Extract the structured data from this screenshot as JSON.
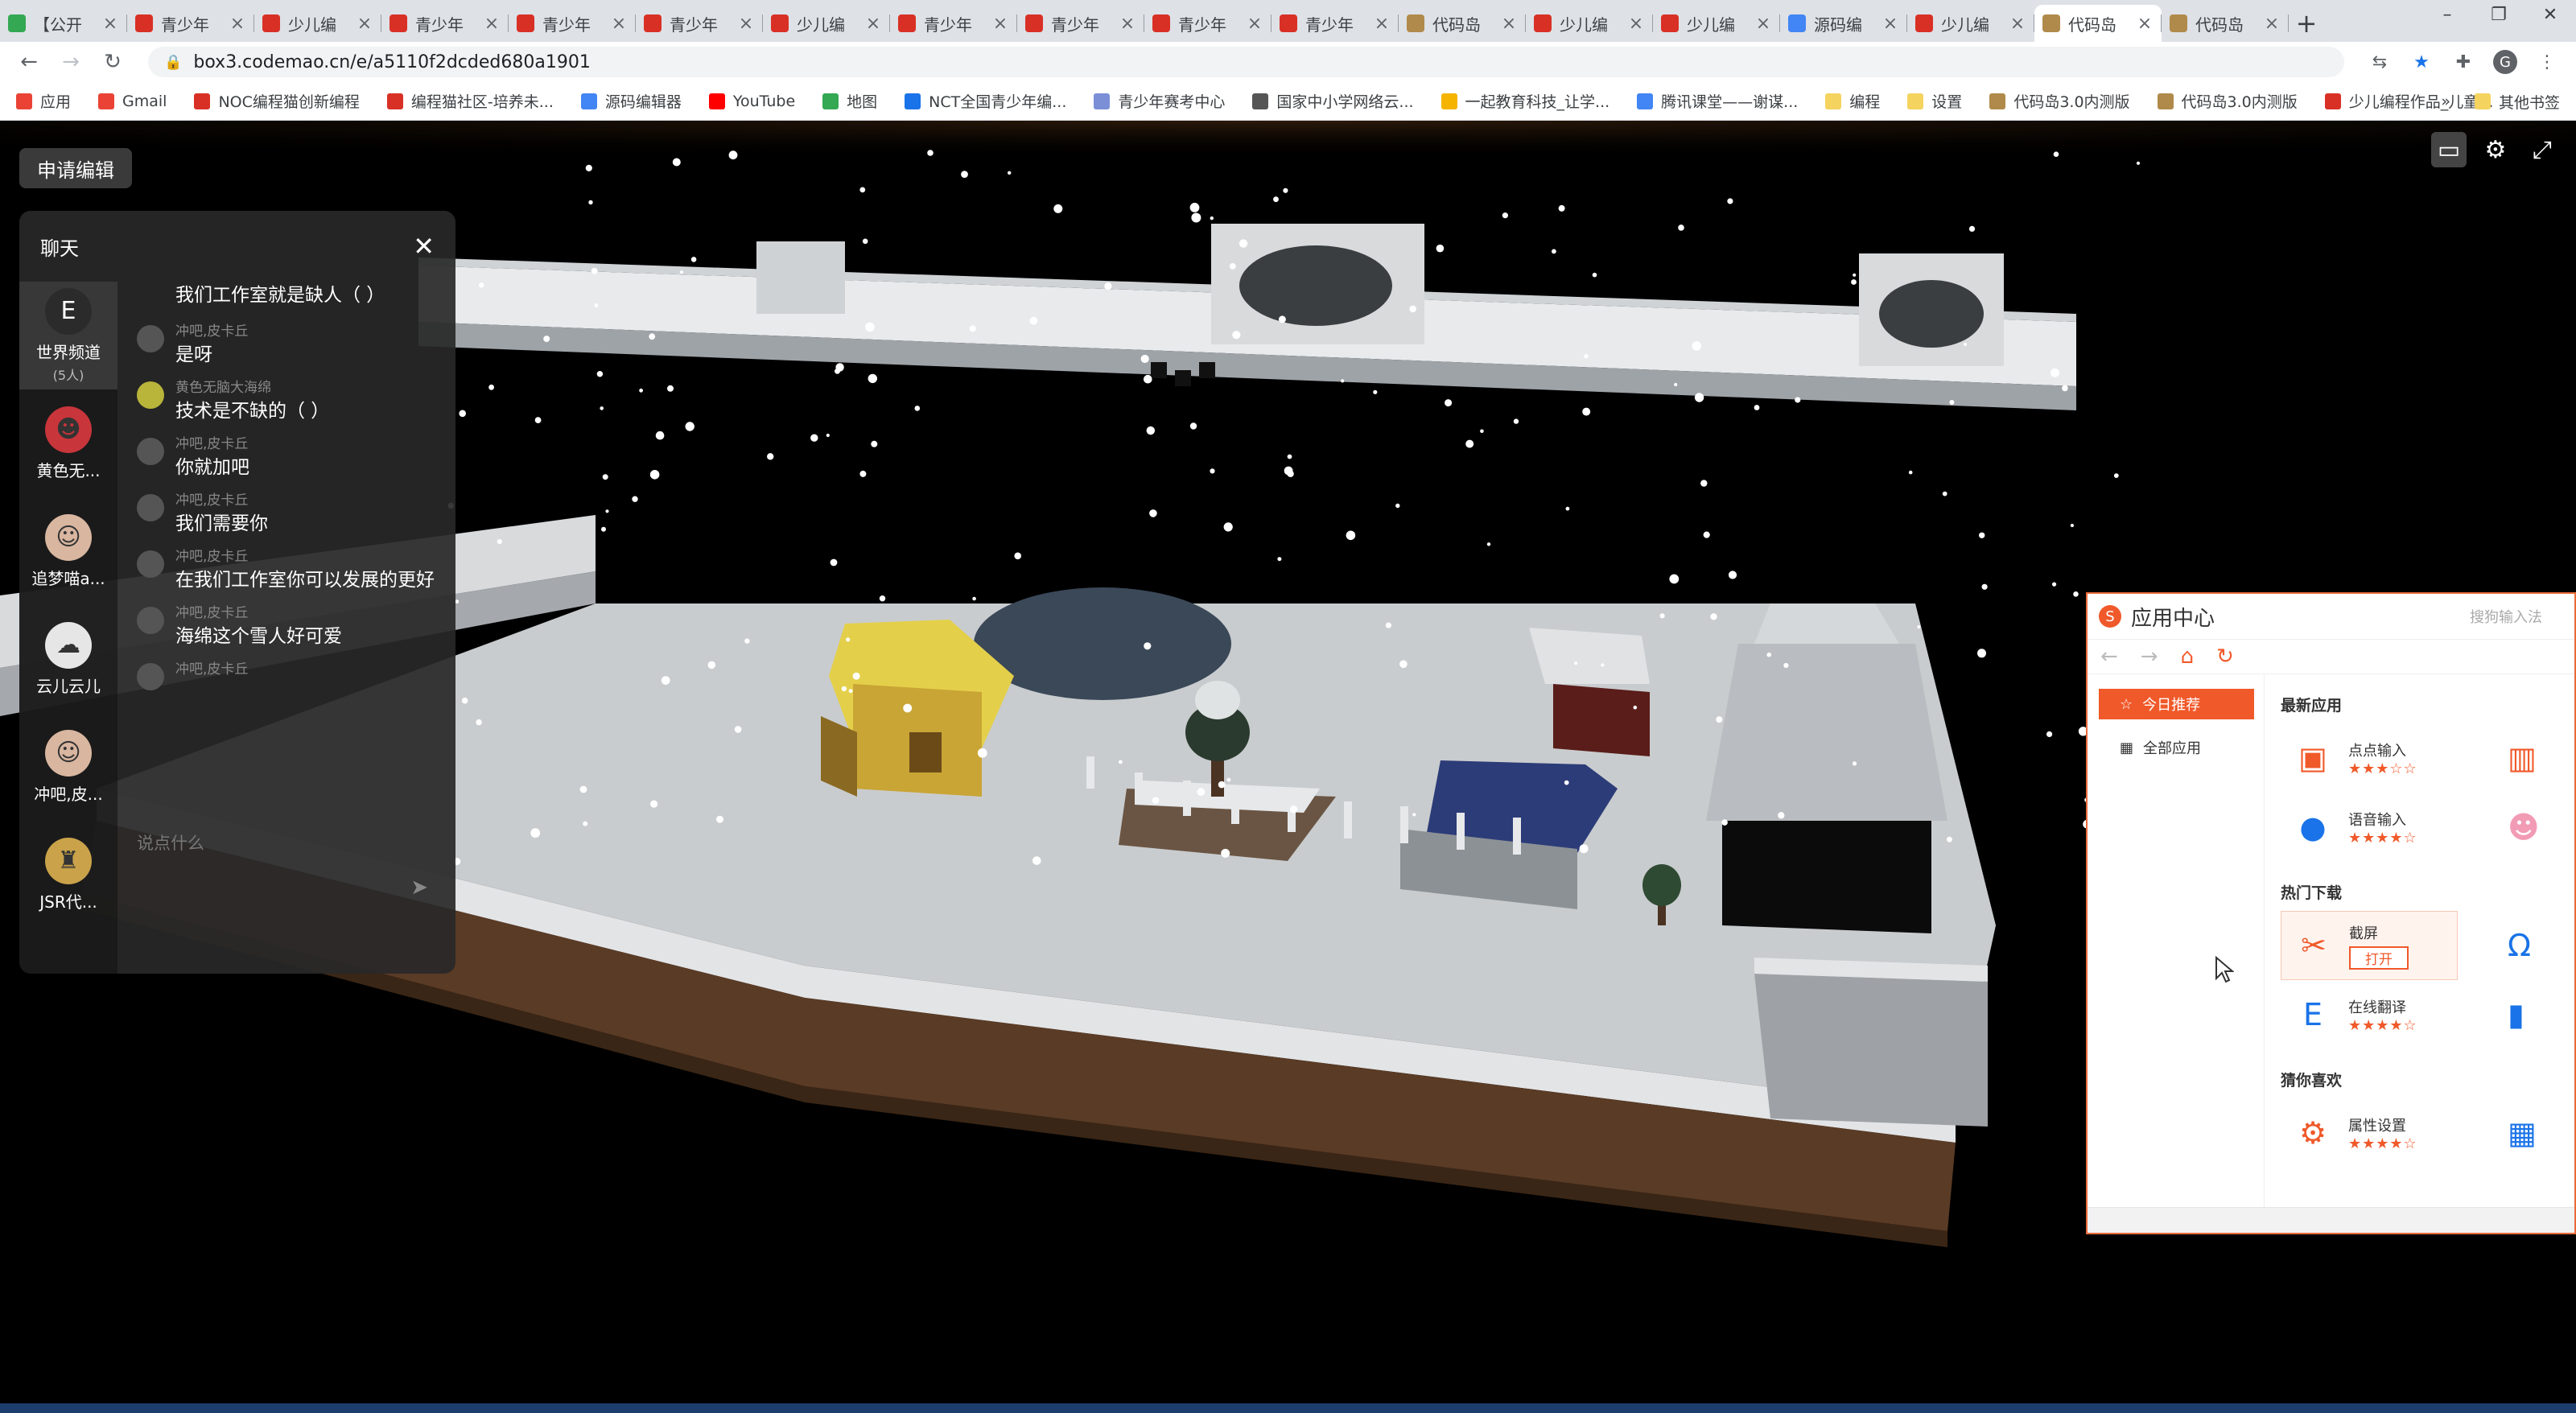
{
  "browser": {
    "tabs": [
      {
        "title": "【公开",
        "color": "#34a853"
      },
      {
        "title": "青少年",
        "color": "#d93025"
      },
      {
        "title": "少儿编",
        "color": "#d93025"
      },
      {
        "title": "青少年",
        "color": "#d93025"
      },
      {
        "title": "青少年",
        "color": "#d93025"
      },
      {
        "title": "青少年",
        "color": "#d93025"
      },
      {
        "title": "少儿编",
        "color": "#d93025"
      },
      {
        "title": "青少年",
        "color": "#d93025"
      },
      {
        "title": "青少年",
        "color": "#d93025"
      },
      {
        "title": "青少年",
        "color": "#d93025"
      },
      {
        "title": "青少年",
        "color": "#d93025"
      },
      {
        "title": "代码岛",
        "color": "#b08a4a"
      },
      {
        "title": "少儿编",
        "color": "#d93025"
      },
      {
        "title": "少儿编",
        "color": "#d93025"
      },
      {
        "title": "源码编",
        "color": "#4285f4"
      },
      {
        "title": "少儿编",
        "color": "#d93025"
      },
      {
        "title": "代码岛",
        "color": "#b08a4a"
      },
      {
        "title": "代码岛",
        "color": "#b08a4a"
      }
    ],
    "active_tab_index": 16,
    "url": "box3.codemao.cn/e/a5110f2dcded680a1901",
    "bookmarks": [
      {
        "label": "应用",
        "color": "#ea4335"
      },
      {
        "label": "Gmail",
        "color": "#ea4335"
      },
      {
        "label": "NOC编程猫创新编程",
        "color": "#d93025"
      },
      {
        "label": "编程猫社区-培养未...",
        "color": "#d93025"
      },
      {
        "label": "源码编辑器",
        "color": "#4285f4"
      },
      {
        "label": "YouTube",
        "color": "#ff0000"
      },
      {
        "label": "地图",
        "color": "#34a853"
      },
      {
        "label": "NCT全国青少年编...",
        "color": "#1a73e8"
      },
      {
        "label": "青少年赛考中心",
        "color": "#7b8fd6"
      },
      {
        "label": "国家中小学网络云...",
        "color": "#555555"
      },
      {
        "label": "一起教育科技_让学...",
        "color": "#f4b400"
      },
      {
        "label": "腾讯课堂——谢谋...",
        "color": "#4285f4"
      },
      {
        "label": "编程",
        "color": "#f4d35e"
      },
      {
        "label": "设置",
        "color": "#f4d35e"
      },
      {
        "label": "代码岛3.0内测版",
        "color": "#b08a4a"
      },
      {
        "label": "代码岛3.0内测版",
        "color": "#b08a4a"
      },
      {
        "label": "少儿编程作品_儿童...",
        "color": "#d93025"
      }
    ],
    "bookmarks_more": "»",
    "other_bookmarks": "其他书签"
  },
  "game": {
    "apply_edit_label": "申请编辑",
    "chat": {
      "title": "聊天",
      "channels": [
        {
          "name": "世界频道",
          "sub": "(5人)",
          "icon": "E"
        },
        {
          "name": "黄色无...",
          "sub": "",
          "icon": "☻"
        },
        {
          "name": "追梦喵a...",
          "sub": "",
          "icon": "☺"
        },
        {
          "name": "云儿云儿",
          "sub": "",
          "icon": "☁"
        },
        {
          "name": "冲吧,皮...",
          "sub": "",
          "icon": "☺"
        },
        {
          "name": "JSR代...",
          "sub": "",
          "icon": "♜"
        }
      ],
      "messages": [
        {
          "name": "",
          "text": "我们工作室就是缺人（ ）"
        },
        {
          "name": "冲吧,皮卡丘",
          "text": "是呀"
        },
        {
          "name": "黄色无脑大海绵",
          "text": "技术是不缺的（ ）"
        },
        {
          "name": "冲吧,皮卡丘",
          "text": "你就加吧"
        },
        {
          "name": "冲吧,皮卡丘",
          "text": "我们需要你"
        },
        {
          "name": "冲吧,皮卡丘",
          "text": "在我们工作室你可以发展的更好"
        },
        {
          "name": "冲吧,皮卡丘",
          "text": "海绵这个雪人好可爱"
        },
        {
          "name": "冲吧,皮卡丘",
          "text": ""
        }
      ],
      "input_placeholder": "说点什么"
    }
  },
  "app_center": {
    "title": "应用中心",
    "hint": "搜狗输入法",
    "sidebar": [
      {
        "label": "今日推荐",
        "active": true
      },
      {
        "label": "全部应用",
        "active": false
      }
    ],
    "sections": [
      {
        "title": "最新应用",
        "apps": [
          {
            "name": "点点输入",
            "stars": "★★★☆☆",
            "icon": "▣",
            "color": "#f0592a"
          },
          {
            "name": "语音输入",
            "stars": "★★★★☆",
            "icon": "●",
            "color": "#1a73e8"
          }
        ]
      },
      {
        "title": "热门下载",
        "apps": [
          {
            "name": "截屏",
            "stars": "",
            "icon": "✂",
            "color": "#f0592a",
            "button": "打开"
          },
          {
            "name": "在线翻译",
            "stars": "★★★★☆",
            "icon": "E",
            "color": "#1a73e8"
          }
        ]
      },
      {
        "title": "猜你喜欢",
        "apps": [
          {
            "name": "属性设置",
            "stars": "★★★★☆",
            "icon": "⚙",
            "color": "#f0592a"
          }
        ]
      }
    ]
  }
}
